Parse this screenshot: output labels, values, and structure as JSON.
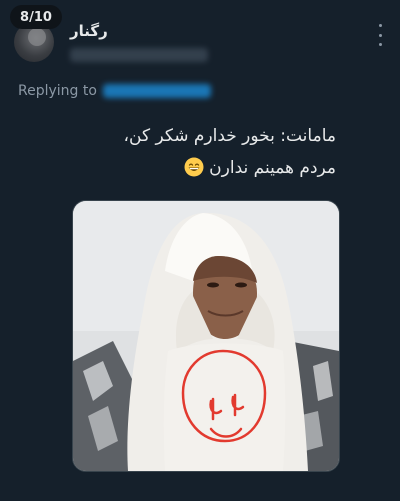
{
  "page_counter": "8/10",
  "author": {
    "display_name": "رگنار"
  },
  "reply": {
    "prefix": "Replying to"
  },
  "tweet": {
    "line1": "مامانت: بخور خدارم شکر کن،",
    "line2": "مردم همینم ندارن",
    "emoji": "grinning-face-emoji"
  },
  "media": {
    "icon": "photo-of-woman-in-white-chador-with-red-smiley-drawing"
  },
  "colors": {
    "background": "#15202b",
    "text": "#e7e9ea",
    "muted": "#8b98a5",
    "accent": "#1d9bf0"
  }
}
